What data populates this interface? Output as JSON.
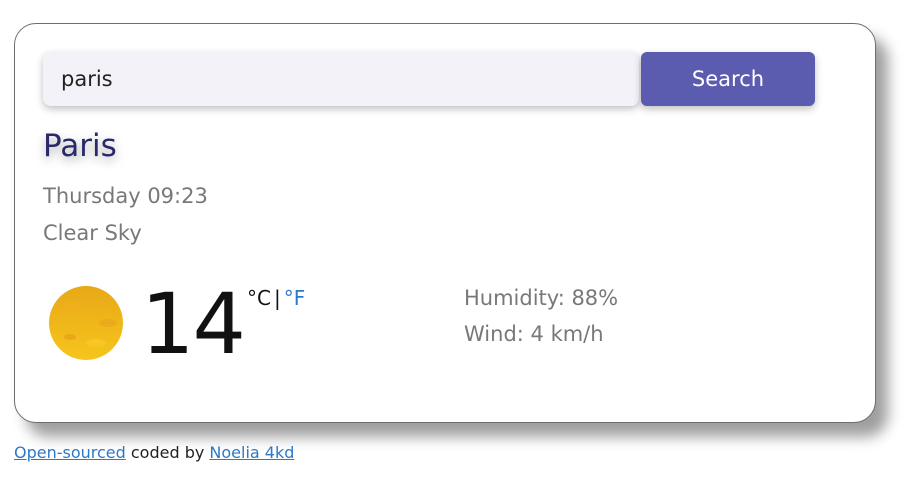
{
  "search": {
    "value": "paris",
    "button_label": "Search"
  },
  "weather": {
    "city": "Paris",
    "date": "Thursday 09:23",
    "condition": "Clear Sky",
    "icon": "sun-icon",
    "temperature": "14",
    "unit_celsius": "°C",
    "unit_separator": "|",
    "unit_fahrenheit": "°F",
    "humidity": "Humidity: 88%",
    "wind": "Wind: 4 km/h"
  },
  "footer": {
    "link_open_source": "Open-sourced",
    "middle_text": " coded by ",
    "link_author": "Noelia 4kd"
  },
  "colors": {
    "accent": "#5b5caf",
    "city_text": "#28286a",
    "link": "#2d78c8",
    "secondary_text": "#787878"
  }
}
